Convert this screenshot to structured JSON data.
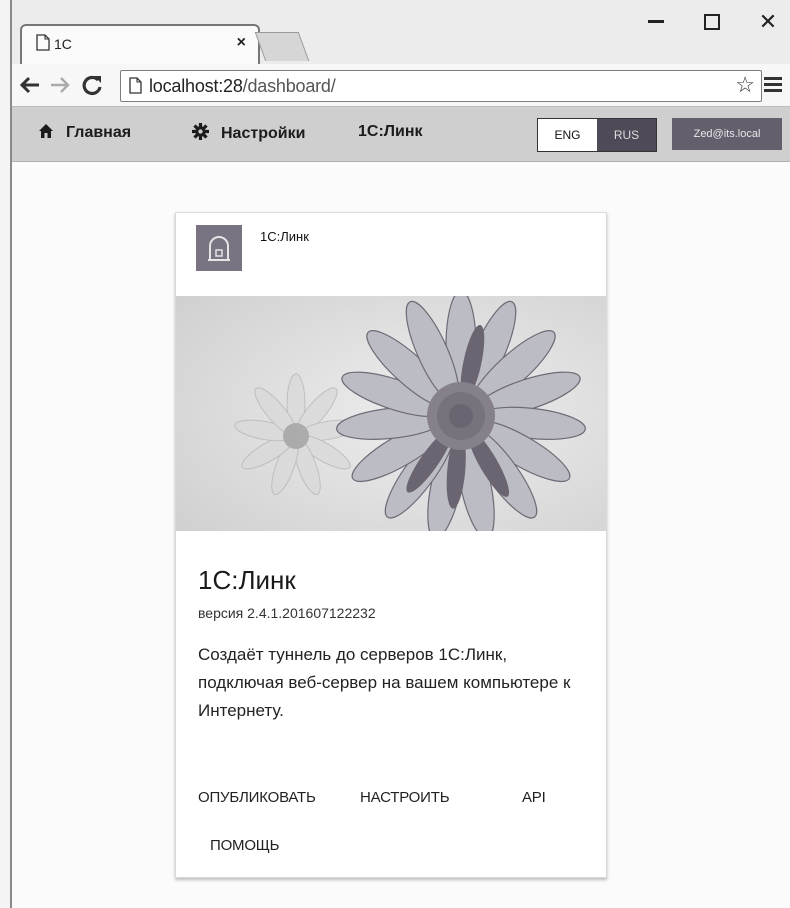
{
  "browser": {
    "tab_title": "1C",
    "tab_close": "×",
    "address": {
      "host": "localhost:28",
      "path": "/dashboard/"
    },
    "controls": {
      "minimize": "minimize-icon",
      "maximize": "maximize-icon",
      "close": "✕"
    }
  },
  "nav": {
    "home": "Главная",
    "settings": "Настройки",
    "link1c": "1С:Линк",
    "lang": {
      "eng": "ENG",
      "rus": "RUS",
      "active": "ENG"
    },
    "user": "Zed@its.local"
  },
  "card": {
    "header_title": "1С:Линк",
    "title": "1С:Линк",
    "version": "версия 2.4.1.201607122232",
    "description": "Создаёт туннель до серверов 1С:Линк, подключая веб-сервер на вашем компьютере к Интернету.",
    "actions": {
      "publish": "ОПУБЛИКОВАТЬ",
      "configure": "НАСТРОИТЬ",
      "api": "API",
      "help": "ПОМОЩЬ"
    }
  },
  "icons": {
    "home": "home-icon",
    "settings": "gear-icon",
    "logo": "app-logo-icon",
    "star": "star-icon",
    "menu": "menu-icon"
  }
}
